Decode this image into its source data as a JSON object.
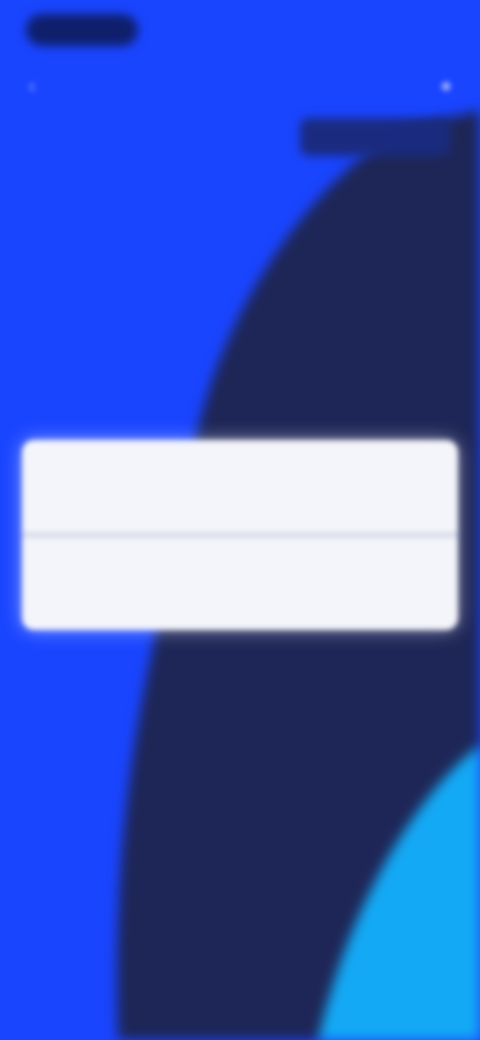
{
  "status_bar": {
    "left_text": "",
    "right_text": ""
  },
  "nav": {
    "back_icon": "chevron-left-icon",
    "title": "",
    "action_icon": "person-icon"
  },
  "header_chip": {
    "label": ""
  },
  "section": {
    "label": ""
  },
  "list": {
    "items": [
      {
        "label": "",
        "value": ""
      },
      {
        "label": "",
        "value": ""
      }
    ]
  },
  "colors": {
    "background": "#1a45ff",
    "navy_shape": "#1e2657",
    "cyan_shape": "#14a9f5",
    "card": "#f4f5fb",
    "row_text": "#6d7fee"
  }
}
